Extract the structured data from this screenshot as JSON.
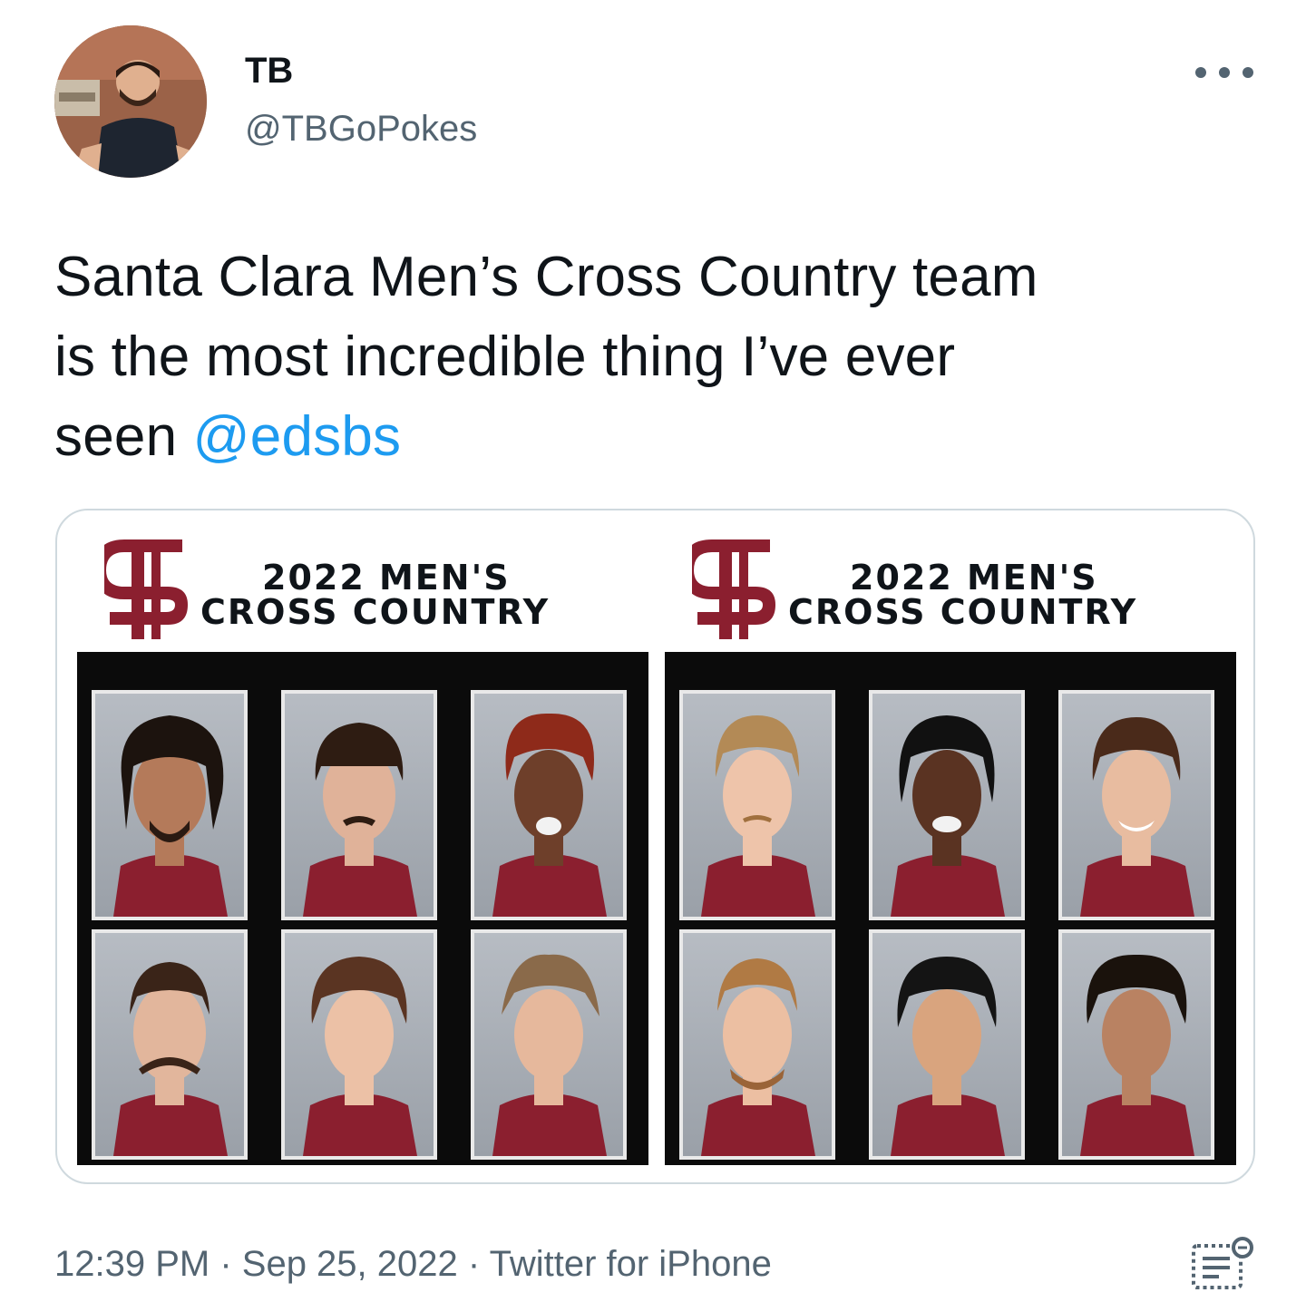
{
  "user": {
    "display_name": "TB",
    "handle": "@TBGoPokes",
    "avatar_icon": "profile-photo"
  },
  "tweet": {
    "text_line1": "Santa Clara Men’s Cross Country team",
    "text_line2": "is the most incredible thing I’ve ever",
    "text_line3_prefix": "seen ",
    "mention": "@edsbs"
  },
  "media": {
    "panels": [
      {
        "title_line1": "2022 MEN'S",
        "title_line2": "CROSS COUNTRY",
        "logo": "santa-clara-sc-logo"
      },
      {
        "title_line1": "2022 MEN'S",
        "title_line2": "CROSS COUNTRY",
        "logo": "santa-clara-sc-logo"
      }
    ]
  },
  "meta": {
    "time": "12:39 PM",
    "separator1": " · ",
    "date": "Sep 25, 2022",
    "separator2": " · ",
    "source": "Twitter for iPhone"
  },
  "colors": {
    "brand_maroon": "#8b1f2f",
    "link_blue": "#1d9bf0",
    "secondary_text": "#536471",
    "border": "#cfd9de"
  },
  "icons": {
    "more": "more-dots-icon",
    "analytics": "analytics-icon"
  }
}
